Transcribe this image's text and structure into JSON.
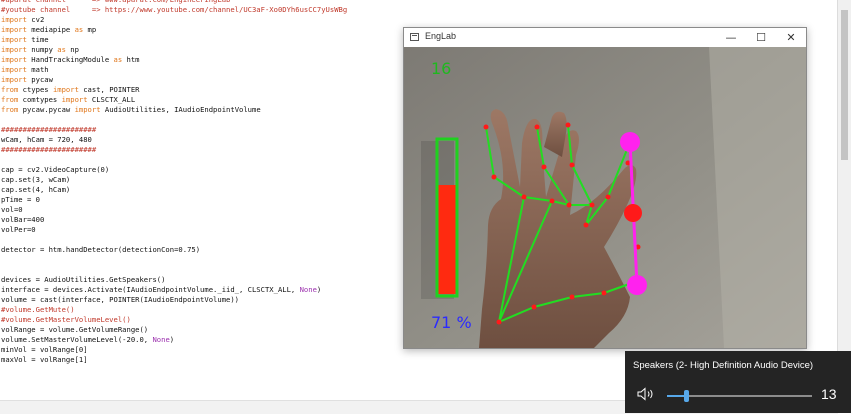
{
  "editor": {
    "lines": [
      {
        "spans": [
          {
            "t": "#aparat channel      => www.aparat.com/EngineeringLab",
            "c": "#c0392b"
          }
        ]
      },
      {
        "spans": [
          {
            "t": "#youtube channel     => https://www.youtube.com/channel/UC3aF-Xo0DYh6usCC7yUsWBg",
            "c": "#c0392b"
          }
        ]
      },
      {
        "spans": [
          {
            "t": "import",
            "c": "#e0761a"
          },
          {
            "t": " cv2",
            "c": "#111111"
          }
        ]
      },
      {
        "spans": [
          {
            "t": "import",
            "c": "#e0761a"
          },
          {
            "t": " mediapipe ",
            "c": "#111111"
          },
          {
            "t": "as",
            "c": "#e0761a"
          },
          {
            "t": " mp",
            "c": "#111111"
          }
        ]
      },
      {
        "spans": [
          {
            "t": "import",
            "c": "#e0761a"
          },
          {
            "t": " time",
            "c": "#111111"
          }
        ]
      },
      {
        "spans": [
          {
            "t": "import",
            "c": "#e0761a"
          },
          {
            "t": " numpy ",
            "c": "#111111"
          },
          {
            "t": "as",
            "c": "#e0761a"
          },
          {
            "t": " np",
            "c": "#111111"
          }
        ]
      },
      {
        "spans": [
          {
            "t": "import",
            "c": "#e0761a"
          },
          {
            "t": " HandTrackingModule ",
            "c": "#111111"
          },
          {
            "t": "as",
            "c": "#e0761a"
          },
          {
            "t": " htm",
            "c": "#111111"
          }
        ]
      },
      {
        "spans": [
          {
            "t": "import",
            "c": "#e0761a"
          },
          {
            "t": " math",
            "c": "#111111"
          }
        ]
      },
      {
        "spans": [
          {
            "t": "import",
            "c": "#e0761a"
          },
          {
            "t": " pycaw",
            "c": "#111111"
          }
        ]
      },
      {
        "spans": [
          {
            "t": "from",
            "c": "#e0761a"
          },
          {
            "t": " ctypes ",
            "c": "#111111"
          },
          {
            "t": "import",
            "c": "#e0761a"
          },
          {
            "t": " cast, POINTER",
            "c": "#111111"
          }
        ]
      },
      {
        "spans": [
          {
            "t": "from",
            "c": "#e0761a"
          },
          {
            "t": " comtypes ",
            "c": "#111111"
          },
          {
            "t": "import",
            "c": "#e0761a"
          },
          {
            "t": " CLSCTX_ALL",
            "c": "#111111"
          }
        ]
      },
      {
        "spans": [
          {
            "t": "from",
            "c": "#e0761a"
          },
          {
            "t": " pycaw.pycaw ",
            "c": "#111111"
          },
          {
            "t": "import",
            "c": "#e0761a"
          },
          {
            "t": " AudioUtilities, IAudioEndpointVolume",
            "c": "#111111"
          }
        ]
      },
      {
        "spans": []
      },
      {
        "spans": [
          {
            "t": "######################",
            "c": "#c0392b"
          }
        ]
      },
      {
        "spans": [
          {
            "t": "wCam, hCam = 720, 480",
            "c": "#111111"
          }
        ]
      },
      {
        "spans": [
          {
            "t": "######################",
            "c": "#c0392b"
          }
        ]
      },
      {
        "spans": []
      },
      {
        "spans": [
          {
            "t": "cap = cv2.VideoCapture(0)",
            "c": "#111111"
          }
        ]
      },
      {
        "spans": [
          {
            "t": "cap.set(3, wCam)",
            "c": "#111111"
          }
        ]
      },
      {
        "spans": [
          {
            "t": "cap.set(4, hCam)",
            "c": "#111111"
          }
        ]
      },
      {
        "spans": [
          {
            "t": "pTime = 0",
            "c": "#111111"
          }
        ]
      },
      {
        "spans": [
          {
            "t": "vol=0",
            "c": "#111111"
          }
        ]
      },
      {
        "spans": [
          {
            "t": "volBar=400",
            "c": "#111111"
          }
        ]
      },
      {
        "spans": [
          {
            "t": "volPer=0",
            "c": "#111111"
          }
        ]
      },
      {
        "spans": []
      },
      {
        "spans": [
          {
            "t": "detector = htm.handDetector(detectionCon=0.75)",
            "c": "#111111"
          }
        ]
      },
      {
        "spans": []
      },
      {
        "spans": []
      },
      {
        "spans": [
          {
            "t": "devices = AudioUtilities.GetSpeakers()",
            "c": "#111111"
          }
        ]
      },
      {
        "spans": [
          {
            "t": "interface = devices.Activate(IAudioEndpointVolume._iid_, CLSCTX_ALL, ",
            "c": "#111111"
          },
          {
            "t": "None",
            "c": "#9b2fae"
          },
          {
            "t": ")",
            "c": "#111111"
          }
        ]
      },
      {
        "spans": [
          {
            "t": "volume = cast(interface, POINTER(IAudioEndpointVolume))",
            "c": "#111111"
          }
        ]
      },
      {
        "spans": [
          {
            "t": "#volume.GetMute()",
            "c": "#c0392b"
          }
        ]
      },
      {
        "spans": [
          {
            "t": "#volume.GetMasterVolumeLevel()",
            "c": "#c0392b"
          }
        ]
      },
      {
        "spans": [
          {
            "t": "volRange = volume.GetVolumeRange()",
            "c": "#111111"
          }
        ]
      },
      {
        "spans": [
          {
            "t": "volume.SetMasterVolumeLevel(-20.0, ",
            "c": "#111111"
          },
          {
            "t": "None",
            "c": "#9b2fae"
          },
          {
            "t": ")",
            "c": "#111111"
          }
        ]
      },
      {
        "spans": [
          {
            "t": "minVol = volRange[0]",
            "c": "#111111"
          }
        ]
      },
      {
        "spans": [
          {
            "t": "maxVol = volRange[1]",
            "c": "#111111"
          }
        ]
      }
    ]
  },
  "camera_window": {
    "title": "EngLab",
    "minimize_glyph": "—",
    "maximize_glyph": "☐",
    "close_glyph": "✕",
    "fps": "16",
    "volume_percent_text": "71 %",
    "volume_fraction": 0.71,
    "colors": {
      "bar_outline": "#1fd11f",
      "bar_fill": "#ff2a10",
      "fps_text": "#1fb81f",
      "percent_text": "#2b2bff",
      "skeleton": "#22dd22",
      "joint": "#ff1a1a",
      "fingertip": "#ff22ee"
    }
  },
  "volume_flyout": {
    "device": "Speakers (2- High Definition Audio Device)",
    "speaker_icon": "speaker-icon",
    "level": 13,
    "level_fraction": 0.13,
    "colors": {
      "accent": "#57a8ea",
      "background": "#242424"
    }
  }
}
